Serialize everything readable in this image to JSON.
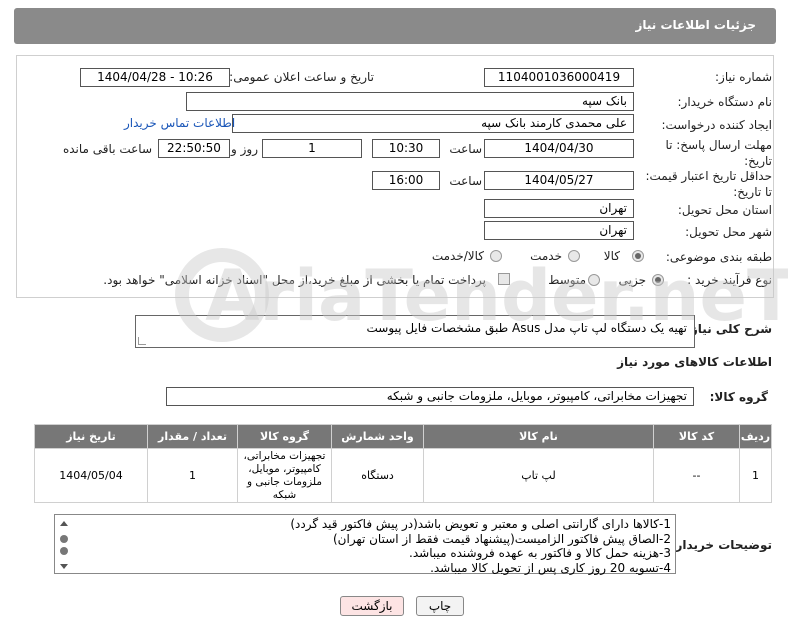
{
  "header": {
    "title": "جزئیات اطلاعات نیاز"
  },
  "fields": {
    "need_number_label": "شماره نیاز:",
    "need_number": "1104001036000419",
    "announce_label": "تاریخ و ساعت اعلان عمومی:",
    "announce_value": "1404/04/28 - 10:26",
    "buyer_org_label": "نام دستگاه خریدار:",
    "buyer_org": "بانک سپه",
    "creator_label": "ایجاد کننده درخواست:",
    "creator": "علی محمدی کارمند بانک سپه",
    "contact_link": "اطلاعات تماس خریدار",
    "deadline_label": "مهلت ارسال پاسخ: تا تاریخ:",
    "deadline_date": "1404/04/30",
    "time_label": "ساعت",
    "deadline_time": "10:30",
    "days_value": "1",
    "days_label": "روز و",
    "remaining_time": "22:50:50",
    "remaining_label": "ساعت باقی مانده",
    "price_validity_label": "حداقل تاریخ اعتبار قیمت: تا تاریخ:",
    "price_date": "1404/05/27",
    "price_time": "16:00",
    "province_label": "استان محل تحویل:",
    "province": "تهران",
    "city_label": "شهر محل تحویل:",
    "city": "تهران",
    "category_label": "طبقه بندی موضوعی:",
    "category_options": [
      "کالا",
      "خدمت",
      "کالا/خدمت"
    ],
    "process_label": "نوع فرآیند خرید :",
    "process_options": [
      "جزیی",
      "متوسط"
    ],
    "payment_note": "پرداخت تمام یا بخشی از مبلغ خرید،از محل \"اسناد خزانه اسلامی\" خواهد بود."
  },
  "description": {
    "label": "شرح کلی نیاز:",
    "text": "تهیه یک دستگاه لپ تاپ مدل Asus طبق مشخصات فایل پیوست"
  },
  "goods_section": {
    "title": "اطلاعات کالاهای مورد نیاز",
    "group_label": "گروه کالا:",
    "group_value": "تجهیزات مخابراتی، کامپیوتر، موبایل، ملزومات جانبی و شبکه"
  },
  "table": {
    "headers": [
      "ردیف",
      "کد کالا",
      "نام کالا",
      "واحد شمارش",
      "گروه کالا",
      "تعداد / مقدار",
      "تاریخ نیاز"
    ],
    "rows": [
      [
        "1",
        "--",
        "لپ تاپ",
        "دستگاه",
        "تجهیزات مخابراتی، کامپیوتر، موبایل، ملزومات جانبی و شبکه",
        "1",
        "1404/05/04"
      ]
    ]
  },
  "notes": {
    "label": "توضیحات خریدار:",
    "lines": [
      "1-کالاها دارای گارانتی اصلی و  معتبر و تعویض باشد(در پیش فاکتور قید گردد)",
      "2-الصاق پیش فاکتور الزامیست(پیشنهاد قیمت فقط از استان تهران)",
      "3-هزینه حمل کالا و فاکتور به عهده فروشنده میباشد.",
      "4-تسویه 20 روز کاری پس از تحویل کالا میباشد."
    ]
  },
  "buttons": {
    "print": "چاپ",
    "back": "بازگشت"
  },
  "watermark": {
    "text": "AriaTender.neT"
  }
}
